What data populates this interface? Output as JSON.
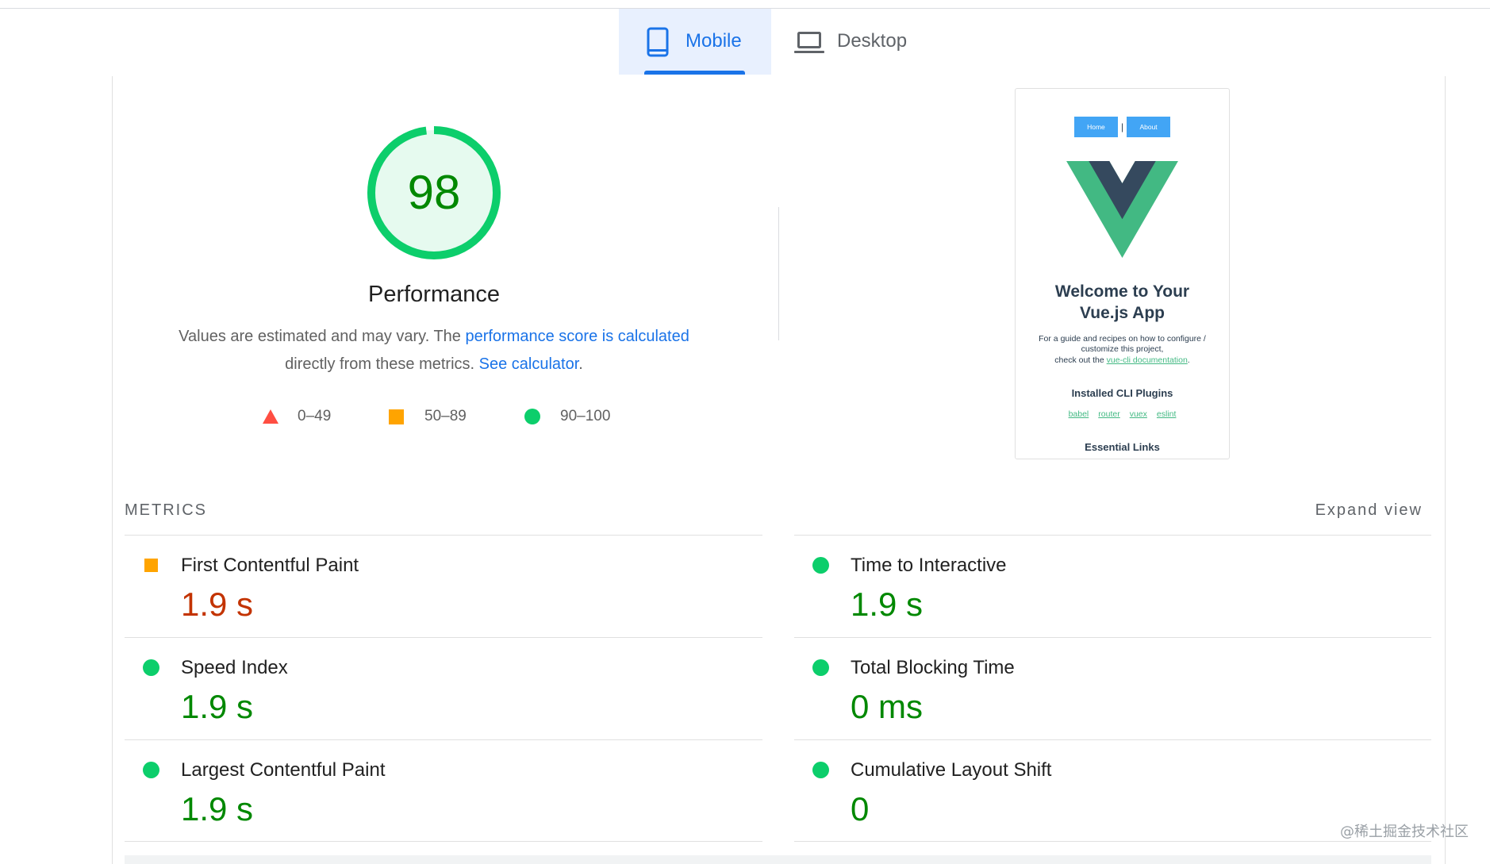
{
  "tabs": {
    "mobile": {
      "label": "Mobile",
      "icon": "phone-icon",
      "active": true
    },
    "desktop": {
      "label": "Desktop",
      "icon": "laptop-icon",
      "active": false
    }
  },
  "gauge": {
    "score": 98,
    "label": "Performance"
  },
  "description": {
    "text_before": "Values are estimated and may vary. The ",
    "score_link": "performance score is calculated",
    "text_middle": "directly from these metrics. ",
    "calculator_link": "See calculator",
    "text_after": "."
  },
  "legend": [
    {
      "range": "0–49",
      "icon": "red-triangle-icon",
      "color": "#ff4e42"
    },
    {
      "range": "50–89",
      "icon": "orange-square-icon",
      "color": "#ffa400"
    },
    {
      "range": "90–100",
      "icon": "green-circle-icon",
      "color": "#0cce6b"
    }
  ],
  "thumbnail": {
    "nav": [
      "Home",
      "About"
    ],
    "separator": "|",
    "logo": "vue-logo-icon",
    "title_line1": "Welcome to Your",
    "title_line2": "Vue.js App",
    "intro_line1": "For a guide and recipes on how to configure /",
    "intro_line2": "customize this project,",
    "intro_line3_prefix": "check out the ",
    "intro_link": "vue-cli documentation",
    "intro_line3_suffix": ".",
    "plugins_heading": "Installed CLI Plugins",
    "plugins": [
      "babel",
      "router",
      "vuex",
      "eslint"
    ],
    "links_heading": "Essential Links"
  },
  "metrics": {
    "heading": "METRICS",
    "expand_label": "Expand view",
    "items": [
      {
        "name": "First Contentful Paint",
        "value": "1.9 s",
        "icon": "orange-square-icon",
        "icon_color": "#ffa400",
        "value_color": "#c33300"
      },
      {
        "name": "Speed Index",
        "value": "1.9 s",
        "icon": "green-circle-icon",
        "icon_color": "#0cce6b",
        "value_color": "#008800"
      },
      {
        "name": "Largest Contentful Paint",
        "value": "1.9 s",
        "icon": "green-circle-icon",
        "icon_color": "#0cce6b",
        "value_color": "#008800"
      },
      {
        "name": "Time to Interactive",
        "value": "1.9 s",
        "icon": "green-circle-icon",
        "icon_color": "#0cce6b",
        "value_color": "#008800"
      },
      {
        "name": "Total Blocking Time",
        "value": "0 ms",
        "icon": "green-circle-icon",
        "icon_color": "#0cce6b",
        "value_color": "#008800"
      },
      {
        "name": "Cumulative Layout Shift",
        "value": "0",
        "icon": "green-circle-icon",
        "icon_color": "#0cce6b",
        "value_color": "#008800"
      }
    ]
  },
  "colors": {
    "accent_blue": "#1a73e8",
    "tab_active_bg": "#e8f0fe",
    "pass": "#0cce6b",
    "pass_text": "#008800",
    "gauge_fill": "#e6faef",
    "average": "#ffa400",
    "average_text": "#c33300",
    "fail": "#ff4e42",
    "vue_green": "#42b983",
    "vue_dark": "#35495e",
    "vue_button": "#42a5f5"
  },
  "watermark": "@稀土掘金技术社区"
}
